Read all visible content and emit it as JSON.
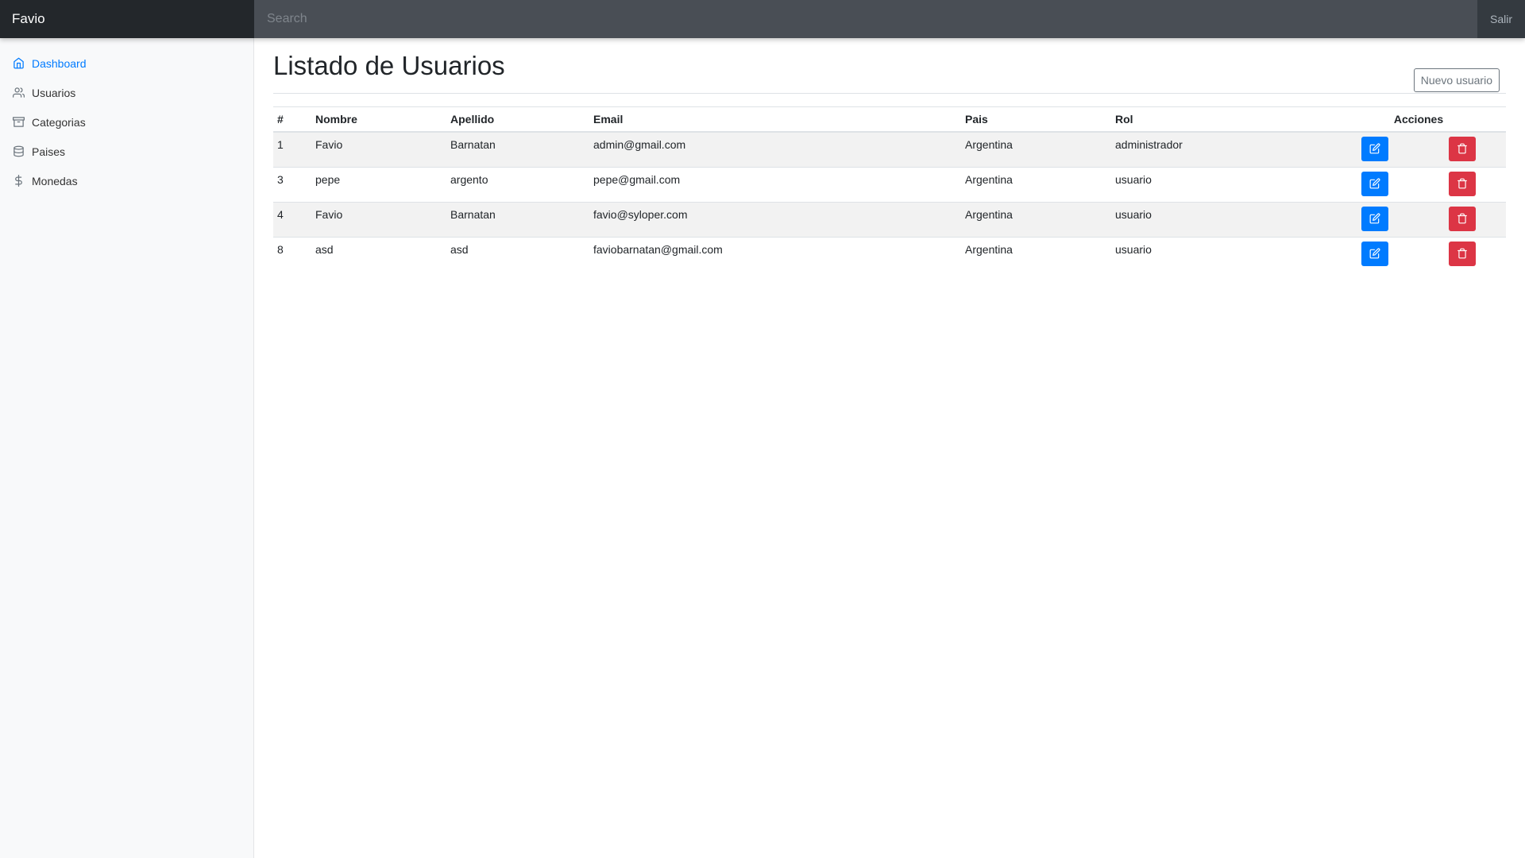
{
  "navbar": {
    "brand": "Favio",
    "search_placeholder": "Search",
    "logout_label": "Salir"
  },
  "sidebar": {
    "items": [
      {
        "label": "Dashboard",
        "icon": "home-icon",
        "active": true
      },
      {
        "label": "Usuarios",
        "icon": "users-icon"
      },
      {
        "label": "Categorias",
        "icon": "archive-icon"
      },
      {
        "label": "Paises",
        "icon": "database-icon"
      },
      {
        "label": "Monedas",
        "icon": "dollar-icon"
      }
    ]
  },
  "main": {
    "title": "Listado de Usuarios",
    "new_button_label": "Nuevo usuario",
    "table": {
      "columns": [
        "#",
        "Nombre",
        "Apellido",
        "Email",
        "Pais",
        "Rol",
        "Acciones"
      ],
      "rows": [
        {
          "id": "1",
          "nombre": "Favio",
          "apellido": "Barnatan",
          "email": "admin@gmail.com",
          "pais": "Argentina",
          "rol": "administrador"
        },
        {
          "id": "3",
          "nombre": "pepe",
          "apellido": "argento",
          "email": "pepe@gmail.com",
          "pais": "Argentina",
          "rol": "usuario"
        },
        {
          "id": "4",
          "nombre": "Favio",
          "apellido": "Barnatan",
          "email": "favio@syloper.com",
          "pais": "Argentina",
          "rol": "usuario"
        },
        {
          "id": "8",
          "nombre": "asd",
          "apellido": "asd",
          "email": "faviobarnatan@gmail.com",
          "pais": "Argentina",
          "rol": "usuario"
        }
      ]
    }
  },
  "colors": {
    "navbar": "#343a40",
    "brand_bg": "#23272b",
    "accent": "#007bff",
    "danger": "#dc3545"
  }
}
